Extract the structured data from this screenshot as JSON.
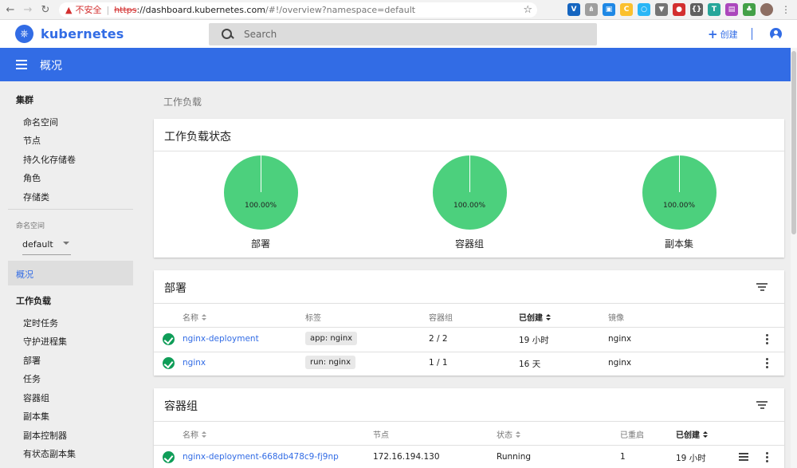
{
  "browser": {
    "security_label": "不安全",
    "url_proto": "https",
    "url_host": "://dashboard.kubernetes.com",
    "url_rest": "/#!/overview?namespace=default"
  },
  "header": {
    "brand": "kubernetes",
    "search_placeholder": "Search",
    "create_label": "创建"
  },
  "toolbar": {
    "title": "概况"
  },
  "sidebar": {
    "cluster": {
      "heading": "集群",
      "items": [
        "命名空间",
        "节点",
        "持久化存储卷",
        "角色",
        "存储类"
      ]
    },
    "namespace_label": "命名空间",
    "namespace_value": "default",
    "overview": "概况",
    "workloads": {
      "heading": "工作负载",
      "items": [
        "定时任务",
        "守护进程集",
        "部署",
        "任务",
        "容器组",
        "副本集",
        "副本控制器",
        "有状态副本集"
      ]
    }
  },
  "breadcrumb": "工作负载",
  "status_card": {
    "title": "工作负载状态",
    "charts": [
      {
        "label": "100.00%",
        "caption": "部署"
      },
      {
        "label": "100.00%",
        "caption": "容器组"
      },
      {
        "label": "100.00%",
        "caption": "副本集"
      }
    ]
  },
  "deployments": {
    "title": "部署",
    "columns": [
      "名称",
      "标签",
      "容器组",
      "已创建",
      "镜像"
    ],
    "rows": [
      {
        "name": "nginx-deployment",
        "label": "app: nginx",
        "pods": "2 / 2",
        "created": "19 小时",
        "image": "nginx"
      },
      {
        "name": "nginx",
        "label": "run: nginx",
        "pods": "1 / 1",
        "created": "16 天",
        "image": "nginx"
      }
    ]
  },
  "pods": {
    "title": "容器组",
    "columns": [
      "名称",
      "节点",
      "状态",
      "已重启",
      "已创建"
    ],
    "rows": [
      {
        "name": "nginx-deployment-668db478c9-fj9np",
        "node": "172.16.194.130",
        "status": "Running",
        "restarts": "1",
        "created": "19 小时"
      }
    ]
  },
  "colors": {
    "primary": "#326ce5",
    "success": "#0f9d58",
    "pie": "#4cd07d"
  }
}
